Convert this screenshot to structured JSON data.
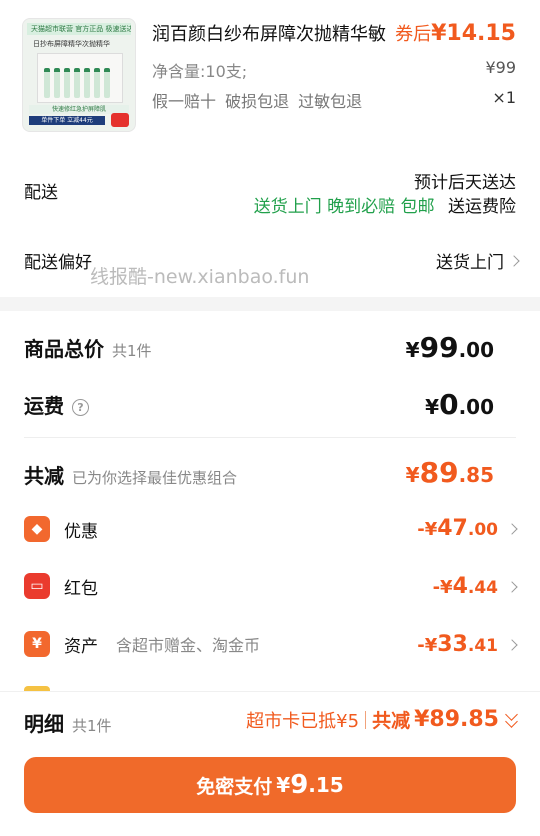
{
  "product": {
    "thumb_tag": "天猫超市联营 官方正品 极速送达",
    "thumb_head": "日抄布屏障精华次抛精华",
    "thumb_bar1": "快速修红急护屏障肌",
    "thumb_bar2": "单件下单 立减44元",
    "title": "润百颜白纱布屏障次抛精华敏",
    "coupon_prefix": "券后",
    "coupon_price": "¥14.15",
    "spec": "净含量:10支;",
    "price": "¥99",
    "guarantees": "假一赔十  破损包退  过敏包退",
    "qty": "×1"
  },
  "delivery": {
    "label": "配送",
    "eta": "预计后天送达",
    "tag_green": "送货上门  晚到必赔  包邮",
    "tag_black": "送运费险"
  },
  "preference": {
    "label": "配送偏好",
    "value": "送货上门"
  },
  "watermark": "线报酷-new.xianbao.fun",
  "totals": {
    "goods_label": "商品总价",
    "goods_count": "共1件",
    "goods_yen": "¥",
    "goods_int": "99",
    "goods_dec": ".00",
    "ship_label": "运费",
    "ship_help": "?",
    "ship_yen": "¥",
    "ship_int": "0",
    "ship_dec": ".00",
    "reduce_label": "共减",
    "reduce_sub": "已为你选择最佳优惠组合",
    "reduce_yen": "¥",
    "reduce_int": "89",
    "reduce_dec": ".85"
  },
  "discounts": [
    {
      "label": "优惠",
      "sub": "",
      "pre": "-¥",
      "int": "47",
      "dec": ".00",
      "icon": "tag-icon",
      "glyph": "◆",
      "color": "#f2682e"
    },
    {
      "label": "红包",
      "sub": "",
      "pre": "-¥",
      "int": "4",
      "dec": ".44",
      "icon": "red-packet-icon",
      "glyph": "▭",
      "color": "#ea3b2e"
    },
    {
      "label": "资产",
      "sub": "含超市赠金、淘金币",
      "pre": "-¥",
      "int": "33",
      "dec": ".41",
      "icon": "yuan-icon",
      "glyph": "¥",
      "color": "#f2682e"
    }
  ],
  "footer": {
    "detail_label": "明细",
    "detail_count": "共1件",
    "card_note": "超市卡已抵¥5",
    "total_label": "共减",
    "total_value": "¥89.85",
    "pay_label": "免密支付",
    "pay_yen": "¥",
    "pay_int": "9",
    "pay_dec": ".15"
  },
  "colors": {
    "accent": "#f15a1e",
    "green": "#21a04b",
    "button": "#f06a2a"
  }
}
